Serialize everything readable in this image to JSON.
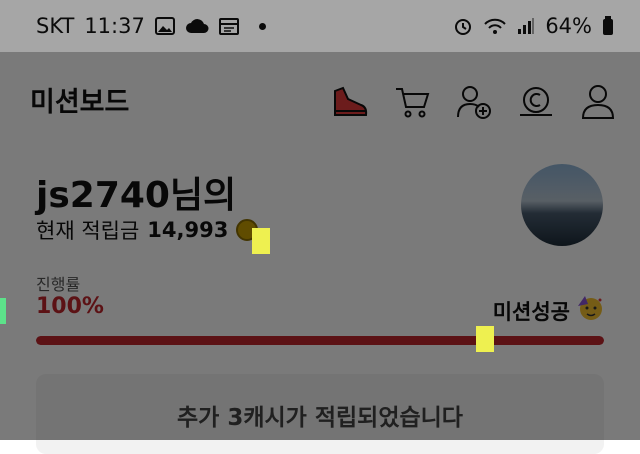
{
  "status_bar": {
    "carrier": "SKT",
    "time": "11:37",
    "battery": "64%",
    "icons": [
      "image-icon",
      "cloud-icon",
      "calendar-icon",
      "alarm-icon",
      "wifi-icon",
      "signal-icon",
      "battery-icon"
    ]
  },
  "header": {
    "title": "미션보드",
    "icons": [
      "shoe-icon",
      "cart-icon",
      "add-user-icon",
      "cash-icon",
      "profile-icon"
    ]
  },
  "user": {
    "title": "js2740님의",
    "points_label": "현재 적립금",
    "points_value": "14,993"
  },
  "progress": {
    "label": "진행률",
    "value_text": "100%",
    "fraction": 1.0,
    "status": "미션성공",
    "color": "#c0272d"
  },
  "notice": {
    "text": "추가 3캐시가 적립되었습니다"
  }
}
